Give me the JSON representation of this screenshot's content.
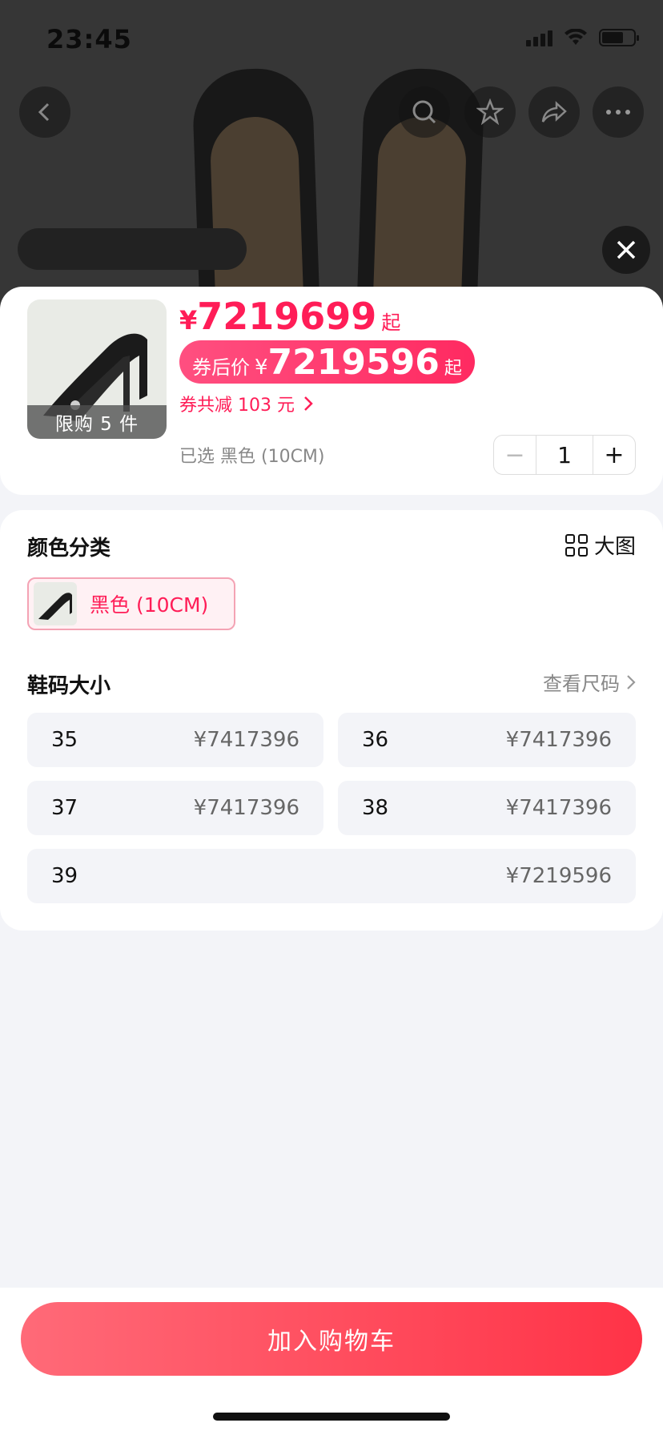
{
  "status_bar": {
    "time": "23:45"
  },
  "top_nav": {
    "icons": [
      "back-icon",
      "search-icon",
      "star-icon",
      "share-icon",
      "more-icon",
      "close-icon"
    ]
  },
  "product": {
    "limit_label": "限购 5 件",
    "price_symbol": "¥",
    "price": "7219699",
    "price_suffix": "起",
    "coupon_label": "券后价",
    "coupon_symbol": "¥",
    "coupon_price": "7219596",
    "coupon_suffix": "起",
    "discount_text": "券共减 103 元",
    "selected_text": "已选 黑色 (10CM)",
    "quantity": "1",
    "minus_label": "−",
    "plus_label": "+"
  },
  "color_section": {
    "title": "颜色分类",
    "big_image_label": "大图",
    "options": [
      {
        "label": "黑色 (10CM)",
        "selected": true
      }
    ]
  },
  "size_section": {
    "title": "鞋码大小",
    "size_chart_label": "查看尺码",
    "sizes": [
      {
        "size": "35",
        "price": "¥7417396"
      },
      {
        "size": "36",
        "price": "¥7417396"
      },
      {
        "size": "37",
        "price": "¥7417396"
      },
      {
        "size": "38",
        "price": "¥7417396"
      },
      {
        "size": "39",
        "price": "¥7219596"
      }
    ]
  },
  "footer": {
    "add_to_cart": "加入购物车"
  },
  "colors": {
    "accent": "#ff1d57",
    "cart_button": "#ff4458"
  }
}
